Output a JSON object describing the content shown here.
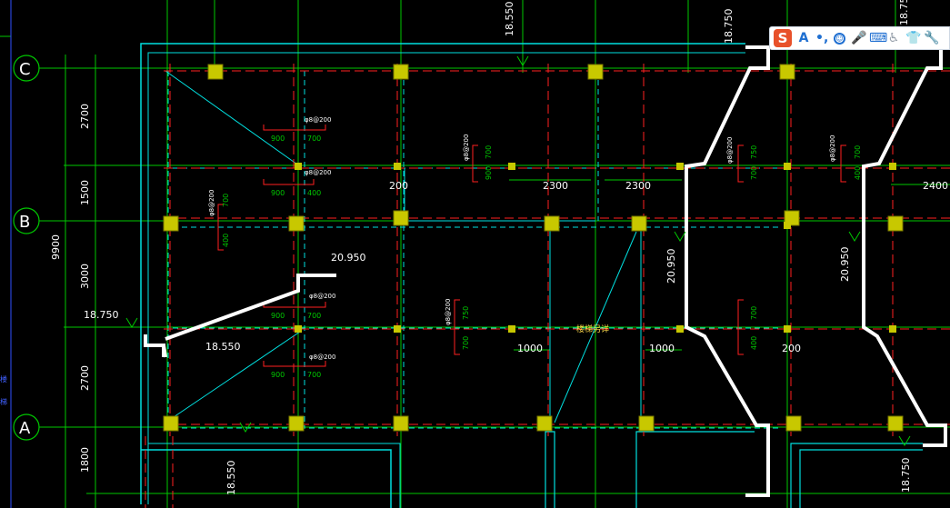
{
  "axes": [
    {
      "label": "C",
      "name": "axis-c-bubble"
    },
    {
      "label": "B",
      "name": "axis-b-bubble"
    },
    {
      "label": "A",
      "name": "axis-a-bubble"
    }
  ],
  "dims_vertical": [
    {
      "text": "2700",
      "name": "dim-2700-upper"
    },
    {
      "text": "1500",
      "name": "dim-1500"
    },
    {
      "text": "3000",
      "name": "dim-3000"
    },
    {
      "text": "2700",
      "name": "dim-2700-lower"
    },
    {
      "text": "1800",
      "name": "dim-1800"
    },
    {
      "text": "9900",
      "name": "dim-9900-total"
    }
  ],
  "dims_horizontal": [
    {
      "text": "200",
      "name": "dim-200-left"
    },
    {
      "text": "2300",
      "name": "dim-2300-a"
    },
    {
      "text": "2300",
      "name": "dim-2300-b"
    },
    {
      "text": "2400",
      "name": "dim-2400"
    },
    {
      "text": "1000",
      "name": "dim-1000-a"
    },
    {
      "text": "1000",
      "name": "dim-1000-b"
    },
    {
      "text": "200",
      "name": "dim-200-right"
    }
  ],
  "elevations": [
    {
      "text": "18.550",
      "name": "elev-18550-top",
      "rot": true
    },
    {
      "text": "18.750",
      "name": "elev-18750-top",
      "rot": true
    },
    {
      "text": "18.750",
      "name": "elev-18750-topright",
      "rot": true
    },
    {
      "text": "20.950",
      "name": "elev-20950-stair",
      "rot": false
    },
    {
      "text": "18.750",
      "name": "elev-18750-left",
      "rot": false
    },
    {
      "text": "18.550",
      "name": "elev-18550-left",
      "rot": false
    },
    {
      "text": "20.950",
      "name": "elev-20950-mid",
      "rot": true
    },
    {
      "text": "20.950",
      "name": "elev-20950-right",
      "rot": true
    },
    {
      "text": "18.550",
      "name": "elev-18550-bottom",
      "rot": true
    },
    {
      "text": "18.750",
      "name": "elev-18750-bottom",
      "rot": true
    }
  ],
  "rebar": [
    {
      "text": "φ8@200",
      "name": "rebar-note-1"
    },
    {
      "text": "φ8@200",
      "name": "rebar-note-2"
    },
    {
      "text": "φ8@200",
      "name": "rebar-note-3"
    },
    {
      "text": "φ8@200",
      "name": "rebar-note-4"
    },
    {
      "text": "φ8@200",
      "name": "rebar-note-5"
    },
    {
      "text": "φ8@200",
      "name": "rebar-note-6"
    },
    {
      "text": "φ8@200",
      "name": "rebar-note-7"
    },
    {
      "text": "φ8@200",
      "name": "rebar-note-8"
    },
    {
      "text": "φ8@200",
      "name": "rebar-note-9"
    }
  ],
  "rebar_dims": [
    "900",
    "700",
    "900",
    "400",
    "900",
    "700",
    "900",
    "700",
    "700",
    "400",
    "700",
    "900",
    "750",
    "700",
    "750",
    "700",
    "700",
    "400",
    "700",
    "400"
  ],
  "center_label": "楼梯另详",
  "side_labels": [
    "楼",
    "梯"
  ],
  "toolbar": {
    "logo": "S",
    "items": [
      {
        "glyph": "A",
        "name": "ime-font-icon",
        "circ": false,
        "grey": false
      },
      {
        "glyph": "•,",
        "name": "ime-punctuation-icon",
        "circ": false,
        "grey": false
      },
      {
        "glyph": "☺",
        "name": "ime-emoji-icon",
        "circ": true,
        "grey": false
      },
      {
        "glyph": "🎤",
        "name": "ime-voice-icon",
        "circ": false,
        "grey": false
      },
      {
        "glyph": "⌨",
        "name": "ime-keyboard-icon",
        "circ": false,
        "grey": false
      },
      {
        "glyph": "♿",
        "name": "ime-accessibility-icon",
        "circ": false,
        "grey": true
      },
      {
        "glyph": "👕",
        "name": "ime-skin-icon",
        "circ": false,
        "grey": false
      },
      {
        "glyph": "🔧",
        "name": "ime-tools-icon",
        "circ": false,
        "grey": false
      }
    ]
  },
  "colors": {
    "bg": "#000000",
    "grid": "#00c800",
    "wall": "#00e0e0",
    "axis": "#ff2020",
    "column": "#c8c800",
    "stair": "#ffffff",
    "text": "#ffffff"
  }
}
